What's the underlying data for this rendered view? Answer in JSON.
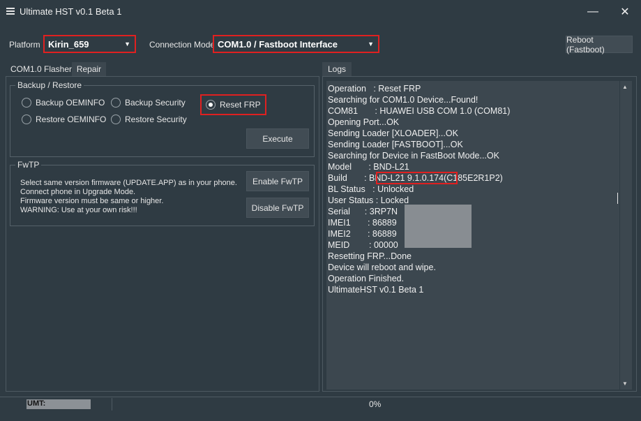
{
  "window": {
    "title": "Ultimate HST v0.1 Beta 1",
    "minimize": "—",
    "close": "✕"
  },
  "toolbar": {
    "platform_label": "Platform",
    "platform_value": "Kirin_659",
    "connection_label": "Connection Mode",
    "connection_value": "COM1.0 / Fastboot Interface",
    "reboot_label": "Reboot (Fastboot)"
  },
  "left_tabs": [
    {
      "label": "COM1.0 Flasher"
    },
    {
      "label": "Repair",
      "active": true
    }
  ],
  "backup_restore": {
    "title": "Backup / Restore",
    "options": [
      {
        "label": "Backup OEMINFO",
        "selected": false
      },
      {
        "label": "Backup Security",
        "selected": false
      },
      {
        "label": "Reset FRP",
        "selected": true
      },
      {
        "label": "Restore OEMINFO",
        "selected": false
      },
      {
        "label": "Restore Security",
        "selected": false
      }
    ],
    "execute_label": "Execute"
  },
  "fwtp": {
    "title": "FwTP",
    "lines": [
      "Select same version firmware (UPDATE.APP) as in your phone.",
      "Connect phone in Upgrade Mode.",
      "Firmware version must be same or higher.",
      "WARNING: Use at your own risk!!!"
    ],
    "enable_label": "Enable FwTP",
    "disable_label": "Disable FwTP"
  },
  "logs": {
    "tab_label": "Logs",
    "lines": [
      "Operation   : Reset FRP",
      "Searching for COM1.0 Device...Found!",
      "COM81       : HUAWEI USB COM 1.0 (COM81)",
      "Opening Port...OK",
      "Sending Loader [XLOADER]...OK",
      "Sending Loader [FASTBOOT]...OK",
      "Searching for Device in FastBoot Mode...OK",
      "Model       : BND-L21",
      "Build       : BND-L21 9.1.0.174(C185E2R1P2)",
      "BL Status   : Unlocked",
      "User Status : Locked",
      "Serial      : 3RP7N",
      "IMEI1       : 86889",
      "IMEI2       : 86889",
      "MEID        : 00000",
      "Resetting FRP...Done",
      "Device will reboot and wipe.",
      "Operation Finished.",
      "UltimateHST v0.1 Beta 1"
    ]
  },
  "status": {
    "umt_label": "UMT:",
    "progress_text": "0%"
  }
}
